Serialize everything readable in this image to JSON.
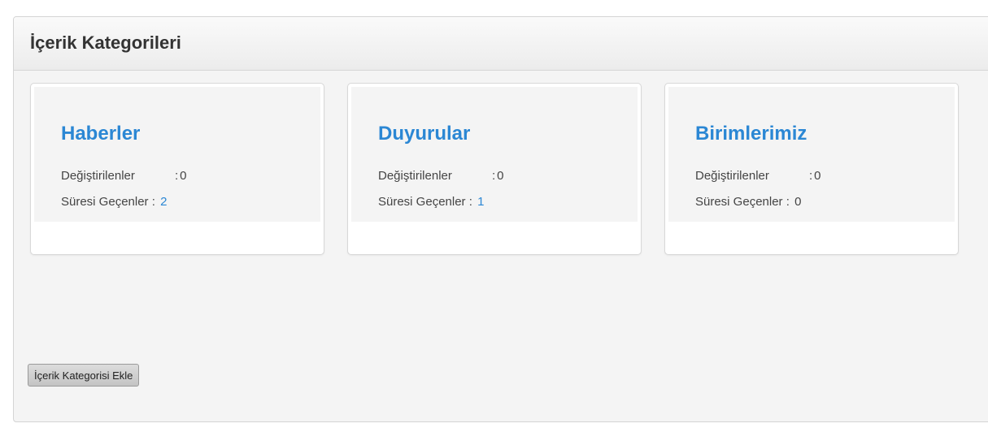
{
  "page": {
    "title": "İçerik Kategorileri",
    "add_button_label": "İçerik Kategorisi Ekle"
  },
  "stats_labels": {
    "modified": "Değiştirilenler",
    "expired": "Süresi Geçenler"
  },
  "categories": [
    {
      "name": "Haberler",
      "modified": "0",
      "expired": "2"
    },
    {
      "name": "Duyurular",
      "modified": "0",
      "expired": "1"
    },
    {
      "name": "Birimlerimiz",
      "modified": "0",
      "expired": "0"
    }
  ],
  "colors": {
    "link": "#2b87d4",
    "text": "#444444",
    "panel_bg": "#f4f4f4"
  }
}
